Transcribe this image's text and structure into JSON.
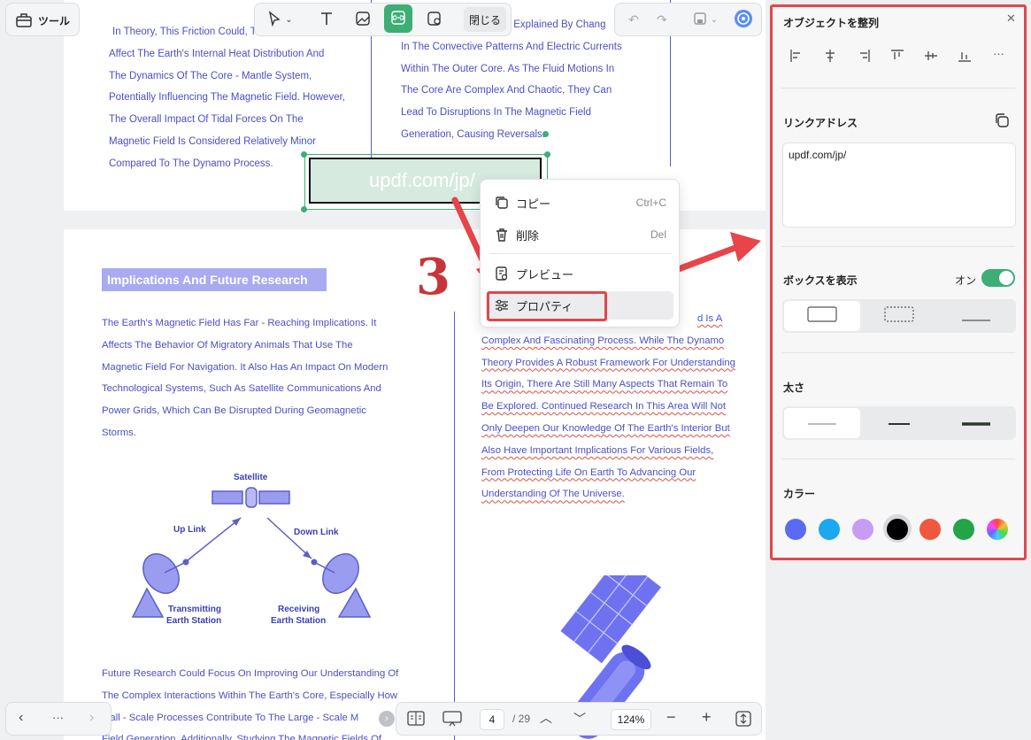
{
  "tools_button": {
    "label": "ツール",
    "icon": "toolbox-icon"
  },
  "top_toolbar": {
    "close_label": "閉じる",
    "tools": [
      "pointer-icon",
      "text-icon",
      "image-icon",
      "link-icon",
      "ocr-icon"
    ]
  },
  "page1": {
    "left_col": [
      "In Theory, This Friction Could, T",
      "Affect The Earth's Internal Heat Distribution And",
      "The Dynamics Of The Core - Mantle System,",
      "Potentially Influencing The Magnetic Field. However,",
      "The Overall Impact Of Tidal Forces On The",
      "Magnetic Field Is Considered Relatively Minor",
      "Compared To The Dynamo Process."
    ],
    "right_col": [
      "Be Explained By Chang",
      "In The Convective Patterns And Electric Currents",
      "Within The Outer Core. As The Fluid Motions In",
      "The Core Are Complex And Chaotic, They Can",
      "Lead To Disruptions In The Magnetic Field",
      "Generation, Causing Reversals."
    ],
    "link_box_text": "updf.com/jp/"
  },
  "page2": {
    "heading": "Implications And Future Research",
    "left_col": [
      "The Earth's Magnetic Field Has Far - Reaching Implications. It",
      "Affects The Behavior Of Migratory Animals That Use The",
      "Magnetic Field For Navigation. It Also Has An Impact On Modern",
      "Technological Systems, Such As Satellite Communications And",
      "Power Grids, Which Can Be Disrupted During Geomagnetic",
      "Storms."
    ],
    "diagram": {
      "satellite": "Satellite",
      "up_link": "Up Link",
      "down_link": "Down Link",
      "tx_line1": "Transmitting",
      "tx_line2": "Earth Station",
      "rx_line1": "Receiving",
      "rx_line2": "Earth Station"
    },
    "bottom_left": [
      "Future Research Could Focus On Improving Our Understanding Of",
      "The Complex Interactions Within The Earth's Core, Especially How",
      "mall - Scale Processes Contribute To The Large - Scale M",
      "Field Generation. Additionally, Studying The Magnetic Fields Of"
    ],
    "right_col": [
      "d Is A",
      "Complex And Fascinating Process. While The Dynamo",
      "Theory Provides A Robust Framework For Understanding",
      "Its Origin, There Are Still Many Aspects That Remain To",
      "Be Explored. Continued Research In This Area Will Not",
      "Only Deepen Our Knowledge Of The Earth's Interior But",
      "Also Have Important Implications For Various Fields,",
      "From Protecting Life On Earth To Advancing Our",
      "Understanding Of The Universe."
    ]
  },
  "annotation": {
    "step_number": "3"
  },
  "context_menu": {
    "items": [
      {
        "label": "コピー",
        "shortcut": "Ctrl+C",
        "icon": "copy-icon"
      },
      {
        "label": "削除",
        "shortcut": "Del",
        "icon": "trash-icon"
      },
      {
        "label": "プレビュー",
        "shortcut": "",
        "icon": "preview-icon"
      },
      {
        "label": "プロパティ",
        "shortcut": "",
        "icon": "properties-icon"
      }
    ]
  },
  "panel": {
    "title": "オブジェクトを整列",
    "link_label": "リンクアドレス",
    "link_value": "updf.com/jp/",
    "show_box_label": "ボックスを表示",
    "toggle_label": "オン",
    "toggle_on": true,
    "thickness_label": "太さ",
    "color_label": "カラー",
    "colors": [
      "#5b6af5",
      "#1aa8f0",
      "#c79cf5",
      "#000000",
      "#f0583d",
      "#22a447",
      "rainbow"
    ],
    "selected_color": "#000000"
  },
  "bottom_bar": {
    "page_current": "4",
    "page_total": "/ 29",
    "zoom": "124%"
  },
  "colors": {
    "accent_green": "#3cae76",
    "highlight_red": "#e0474c",
    "text_blue": "#4a4fc6"
  }
}
